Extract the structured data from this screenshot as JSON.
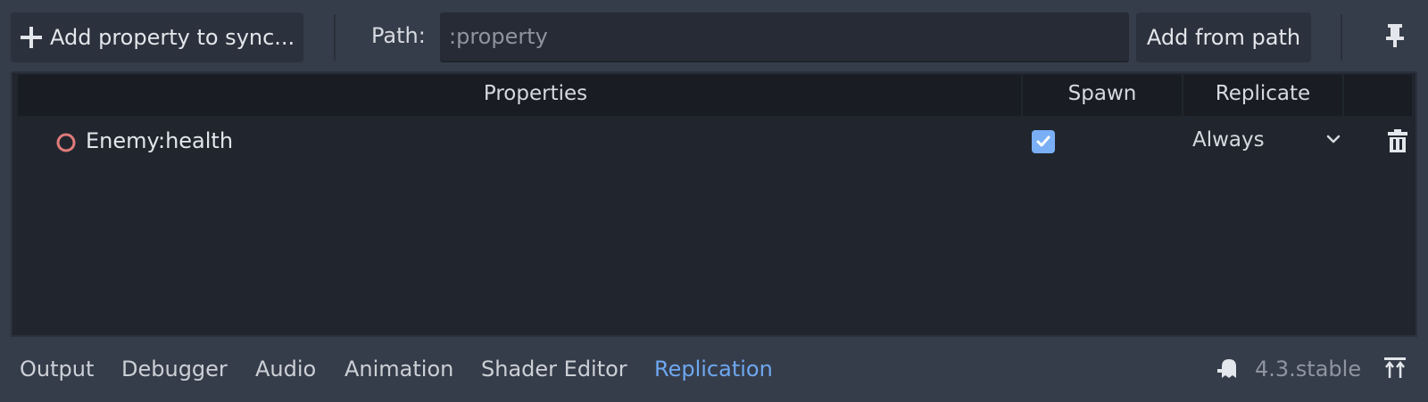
{
  "toolbar": {
    "add_property_label": "Add property to sync...",
    "path_label": "Path:",
    "path_placeholder": ":property",
    "add_from_path_label": "Add from path"
  },
  "table": {
    "headers": [
      "Properties",
      "Spawn",
      "Replicate"
    ],
    "rows": [
      {
        "property": "Enemy:health",
        "spawn": true,
        "replicate": "Always"
      }
    ]
  },
  "bottom_tabs": [
    "Output",
    "Debugger",
    "Audio",
    "Animation",
    "Shader Editor",
    "Replication"
  ],
  "active_tab": "Replication",
  "version": "4.3.stable",
  "icons": {
    "add": "plus-icon",
    "pin": "pin-icon",
    "property": "ring-icon",
    "checkbox": "check-icon",
    "dropdown": "chevron-down-icon",
    "remove": "trash-icon",
    "editor": "ghost-icon",
    "panel_toggle": "expand-panel-icon"
  },
  "colors": {
    "accent": "#6ea7f0",
    "checkbox": "#7aaff6",
    "property_icon": "#e07b7b"
  }
}
